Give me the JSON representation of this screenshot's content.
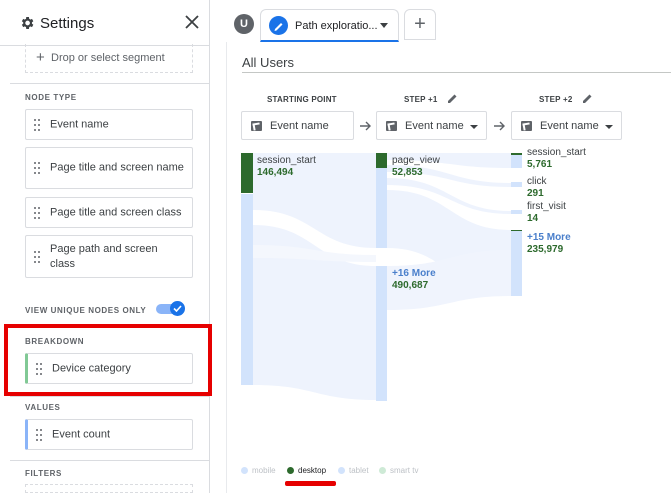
{
  "settings": {
    "title": "Settings",
    "segment_placeholder": "Drop or select segment",
    "node_type_label": "NODE TYPE",
    "node_types": [
      "Event name",
      "Page title and screen name",
      "Page title and screen class",
      "Page path and screen class"
    ],
    "unique_nodes_label": "VIEW UNIQUE NODES ONLY",
    "unique_nodes_on": true,
    "breakdown_label": "BREAKDOWN",
    "breakdown_value": "Device category",
    "values_label": "VALUES",
    "values_value": "Event count",
    "filters_label": "FILTERS"
  },
  "tabs": {
    "user_badge": "U",
    "active_tab": "Path exploratio...",
    "add_label": "+"
  },
  "canvas": {
    "segment_title": "All Users",
    "steps": [
      {
        "label": "STARTING POINT",
        "dimension": "Event name"
      },
      {
        "label": "STEP +1",
        "dimension": "Event name"
      },
      {
        "label": "STEP +2",
        "dimension": "Event name"
      }
    ],
    "nodes": {
      "start": [
        {
          "label": "session_start",
          "value": "146,494"
        }
      ],
      "step1": [
        {
          "label": "page_view",
          "value": "52,853"
        },
        {
          "label": "+16 More",
          "value": "490,687"
        }
      ],
      "step2": [
        {
          "label": "session_start",
          "value": "5,761"
        },
        {
          "label": "click",
          "value": "291"
        },
        {
          "label": "first_visit",
          "value": "14"
        },
        {
          "label": "+15 More",
          "value": "235,979"
        }
      ]
    },
    "legend": [
      {
        "label": "mobile",
        "active": false
      },
      {
        "label": "desktop",
        "active": true
      },
      {
        "label": "tablet",
        "active": false
      },
      {
        "label": "smart tv",
        "active": false
      }
    ]
  },
  "colors": {
    "desktop_green": "#2d6a2d",
    "mobile_blue": "#d2e3fc",
    "accent_blue": "#1a73e8",
    "highlight_red": "#e60000"
  }
}
